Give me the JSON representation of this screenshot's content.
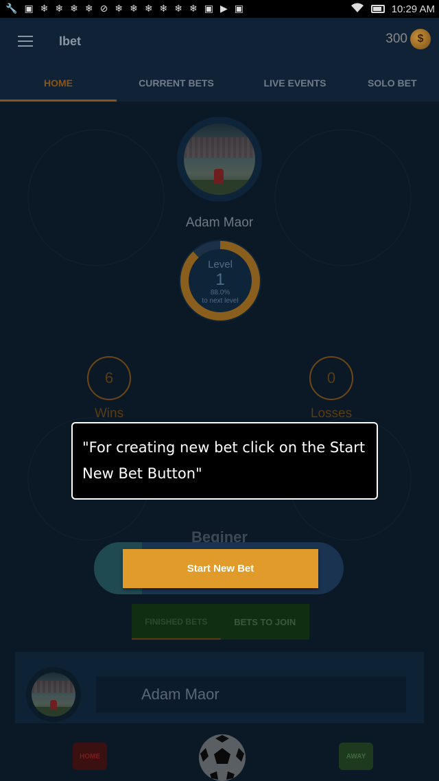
{
  "status_bar": {
    "icons": [
      "wrench-icon",
      "image-icon",
      "snowflake-icon",
      "snowflake-icon",
      "snowflake-icon",
      "snowflake-icon",
      "block-icon",
      "snowflake-icon",
      "snowflake-icon",
      "snowflake-icon",
      "snowflake-icon",
      "snowflake-icon",
      "snowflake-icon",
      "photo-icon",
      "youtube-icon",
      "photo-icon"
    ],
    "time": "10:29 AM"
  },
  "app_bar": {
    "title": "Ibet",
    "coins": "300",
    "coin_symbol": "$"
  },
  "tabs": [
    {
      "label": "HOME",
      "active": true
    },
    {
      "label": "CURRENT BETS",
      "active": false
    },
    {
      "label": "LIVE EVENTS",
      "active": false
    },
    {
      "label": "SOLO BET",
      "active": false
    }
  ],
  "profile": {
    "name": "Adam Maor",
    "level_label": "Level",
    "level": "1",
    "level_progress_pct": "88.0%",
    "level_progress_fraction": 0.88,
    "level_progress_text": "to next level"
  },
  "stats": {
    "wins_value": "6",
    "wins_label": "Wins",
    "losses_value": "0",
    "losses_label": "Losses"
  },
  "rank_progress": {
    "value_partial": "25"
  },
  "rank": "Beginer",
  "start_bet": {
    "label": "Start New Bet"
  },
  "sub_tabs": {
    "finished": "FINISHED BETS",
    "join": "BETS TO JOIN"
  },
  "bet_card": {
    "name": "Adam Maor"
  },
  "bottom": {
    "home_label": "HOME",
    "away_label": "AWAY"
  },
  "tooltip": {
    "text": "\"For creating new bet click on the Start New Bet Button\""
  },
  "colors": {
    "accent": "#e09b2a",
    "background": "#0b1826",
    "tab_active": "#8a5416"
  }
}
